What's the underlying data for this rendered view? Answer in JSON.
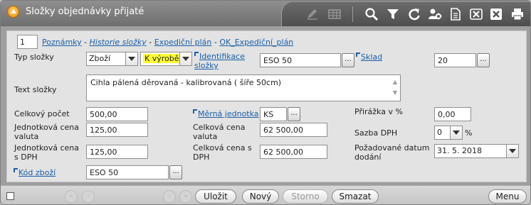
{
  "window": {
    "title": "Složky objednávky přijaté"
  },
  "toolbar": {
    "icons": [
      "edit-icon",
      "table-icon",
      "search-icon",
      "filter-icon",
      "refresh-icon",
      "user-settings-icon",
      "document-icon",
      "excel-icon",
      "close-icon",
      "print-icon"
    ]
  },
  "nav": {
    "record_number": "1",
    "links": [
      "Poznámky",
      "Historie složky",
      "Expediční plán",
      "OK_Expediční_plán"
    ],
    "separator": "-"
  },
  "form": {
    "typ_slozky": {
      "label": "Typ složky",
      "value1": "Zboží",
      "value2": "K výrobě"
    },
    "identifikace": {
      "label": "Identifikace složky",
      "value": "ESO 50"
    },
    "sklad": {
      "label": "Sklad",
      "value": "20"
    },
    "text_slozky": {
      "label": "Text složky",
      "value": "Cihla pálená děrovaná - kalibrovaná ( šíře 50cm)"
    },
    "celkovy_pocet": {
      "label": "Celkový počet",
      "value": "500,00"
    },
    "merna_jednotka": {
      "label": "Měrná jednotka",
      "value": "KS"
    },
    "prirazka": {
      "label": "Přirážka v %",
      "value": "0,00"
    },
    "jednotkova_cena_valuta": {
      "label": "Jednotková cena valuta",
      "value": "125,00"
    },
    "celkova_cena_valuta": {
      "label": "Celková cena valuta",
      "value": "62 500,00"
    },
    "sazba_dph": {
      "label": "Sazba DPH",
      "value": "0",
      "unit": "%"
    },
    "jednotkova_cena_dph": {
      "label": "Jednotková cena s DPH",
      "value": "125,00"
    },
    "celkova_cena_dph": {
      "label": "Celková cena s DPH",
      "value": "62 500,00"
    },
    "datum_dodani": {
      "label": "Požadované datum dodání",
      "value": "31. 5. 2018"
    },
    "kod_zbozi": {
      "label": "Kód zboží",
      "value": "ESO 50"
    },
    "dots": "..."
  },
  "footer": {
    "save": "Uložit",
    "new": "Nový",
    "cancel": "Storno",
    "delete": "Smazat",
    "menu": "Menu"
  },
  "colors": {
    "highlight": "#ffff33",
    "link": "#1a5fa8"
  }
}
